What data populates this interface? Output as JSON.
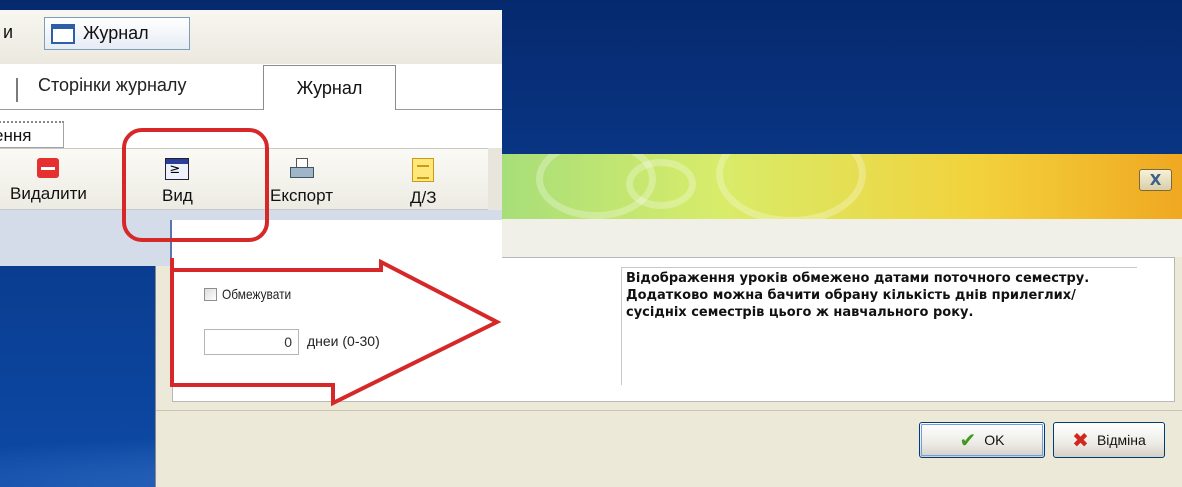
{
  "journal": {
    "prev_tab_label": "и",
    "window_tab_label": "Журнал",
    "tabs": [
      {
        "label": "Сторінки журналу"
      },
      {
        "label": "Журнал"
      }
    ],
    "subtab_label": "ення",
    "toolbar": {
      "delete_label": "Видалити",
      "view_label": "Вид",
      "export_label": "Експорт",
      "homework_label": "Д/З"
    }
  },
  "dialog": {
    "close_glyph": "X",
    "limit_checkbox_label": "Обмежувати",
    "limit_checked": false,
    "days_value": "0",
    "days_label": "днеи (0-30)",
    "info_text": "Відображення уроків обмежено датами поточного семестру. Додатково можна бачити обрану кількість днів прилеглих/сусідніх семестрів цього ж навчального року.",
    "ok_label": "OK",
    "cancel_label": "Відміна"
  },
  "icons": {
    "delete": "delete-icon",
    "view": "view-icon",
    "export": "printer-icon",
    "homework": "homework-icon",
    "ok": "checkmark-icon",
    "cancel": "cross-icon",
    "window": "window-icon"
  },
  "colors": {
    "desktop": "#0a3a8c",
    "annotation": "#d62828",
    "dialog_bg": "#ece9d8"
  }
}
